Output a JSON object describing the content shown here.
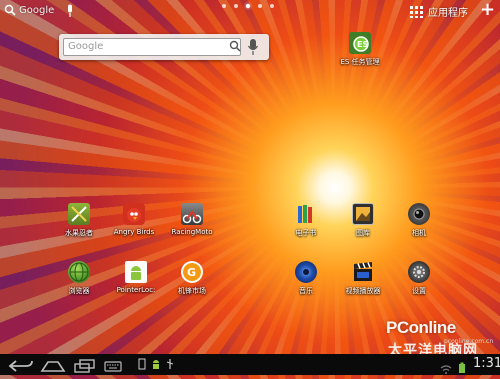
{
  "statusbar": {
    "google_label": "Google",
    "apps_label": "应用程序",
    "page_dots": 5,
    "active_dot": 3
  },
  "search_widget": {
    "placeholder": "Google"
  },
  "icons": [
    {
      "name": "es-file-manager",
      "label": "ES 任务管理",
      "color": "#4a8a2a"
    },
    {
      "name": "fruit-ninja",
      "label": "水果忍者",
      "color": "#6c8a2c"
    },
    {
      "name": "angry-birds",
      "label": "Angry Birds",
      "color": "#c9281a"
    },
    {
      "name": "racing-moto",
      "label": "RacingMoto",
      "color": "#6a6a6a"
    },
    {
      "name": "ebook",
      "label": "电子书",
      "color": "#2a6ad0"
    },
    {
      "name": "gallery",
      "label": "图库",
      "color": "#3a3a3a"
    },
    {
      "name": "camera",
      "label": "相机",
      "color": "#444444"
    },
    {
      "name": "browser",
      "label": "浏览器",
      "color": "#4c9a2c"
    },
    {
      "name": "pointer-location",
      "label": "PointerLoc:",
      "color": "#7ab030"
    },
    {
      "name": "market",
      "label": "机锋市场",
      "color": "#f08a00"
    },
    {
      "name": "music",
      "label": "音乐",
      "color": "#1d3f8a"
    },
    {
      "name": "video-player",
      "label": "视频播放器",
      "color": "#222222"
    },
    {
      "name": "settings",
      "label": "设置",
      "color": "#333333"
    }
  ],
  "navbar": {
    "time": "1:31"
  },
  "watermark": {
    "brand": "PConline",
    "sub": "太平洋电脑网",
    "domain": "pconline.com.cn"
  }
}
